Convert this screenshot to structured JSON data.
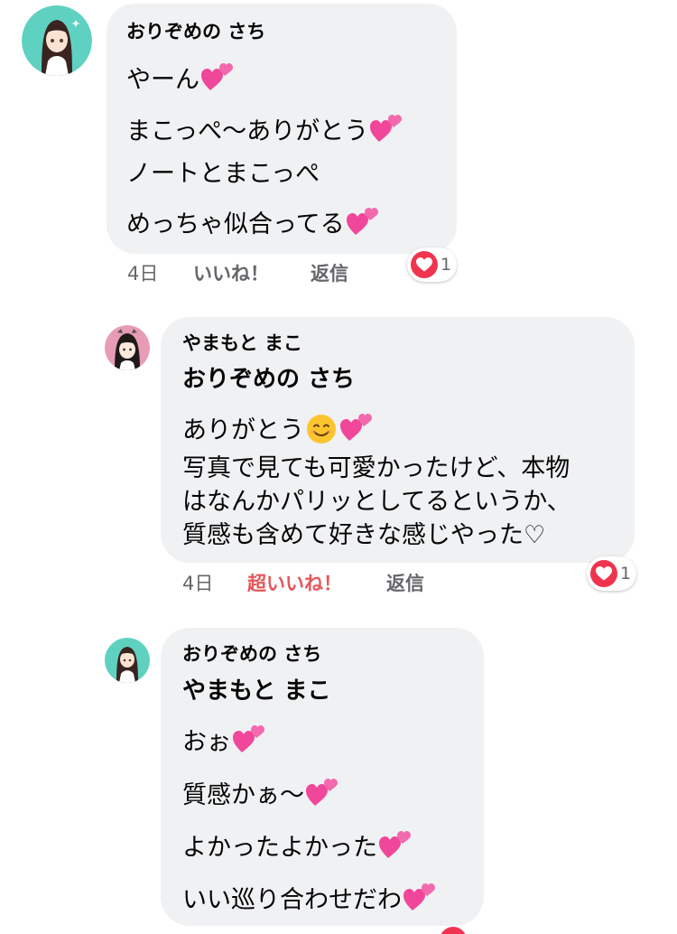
{
  "comments": [
    {
      "author": "おりぞめの さち",
      "mention": "",
      "lines": [
        "やーん",
        "まこっぺ〜ありがとう",
        "ノートとまこっぺ",
        "めっちゃ似合ってる"
      ],
      "time": "4日",
      "like_label": "いいね！",
      "reply_label": "返信",
      "reaction_count": "1"
    },
    {
      "author": "やまもと まこ",
      "mention": "おりぞめの さち",
      "lines": [
        "ありがとう",
        "写真で見ても可愛かったけど、本物",
        "はなんかパリッとしてるというか、",
        "質感も含めて好きな感じやった♡"
      ],
      "time": "4日",
      "like_label": "超いいね！",
      "reply_label": "返信",
      "reaction_count": "1"
    },
    {
      "author": "おりぞめの さち",
      "mention": "やまもと まこ",
      "lines": [
        "おぉ",
        "質感かぁ〜",
        "よかったよかった",
        "いい巡り合わせだわ"
      ]
    }
  ],
  "colors": {
    "bubble": "#f0f1f3",
    "super_like": "#e4575c",
    "meta": "#65676b",
    "heart": "#f0344f",
    "emoji_heart": "#f0479a"
  }
}
